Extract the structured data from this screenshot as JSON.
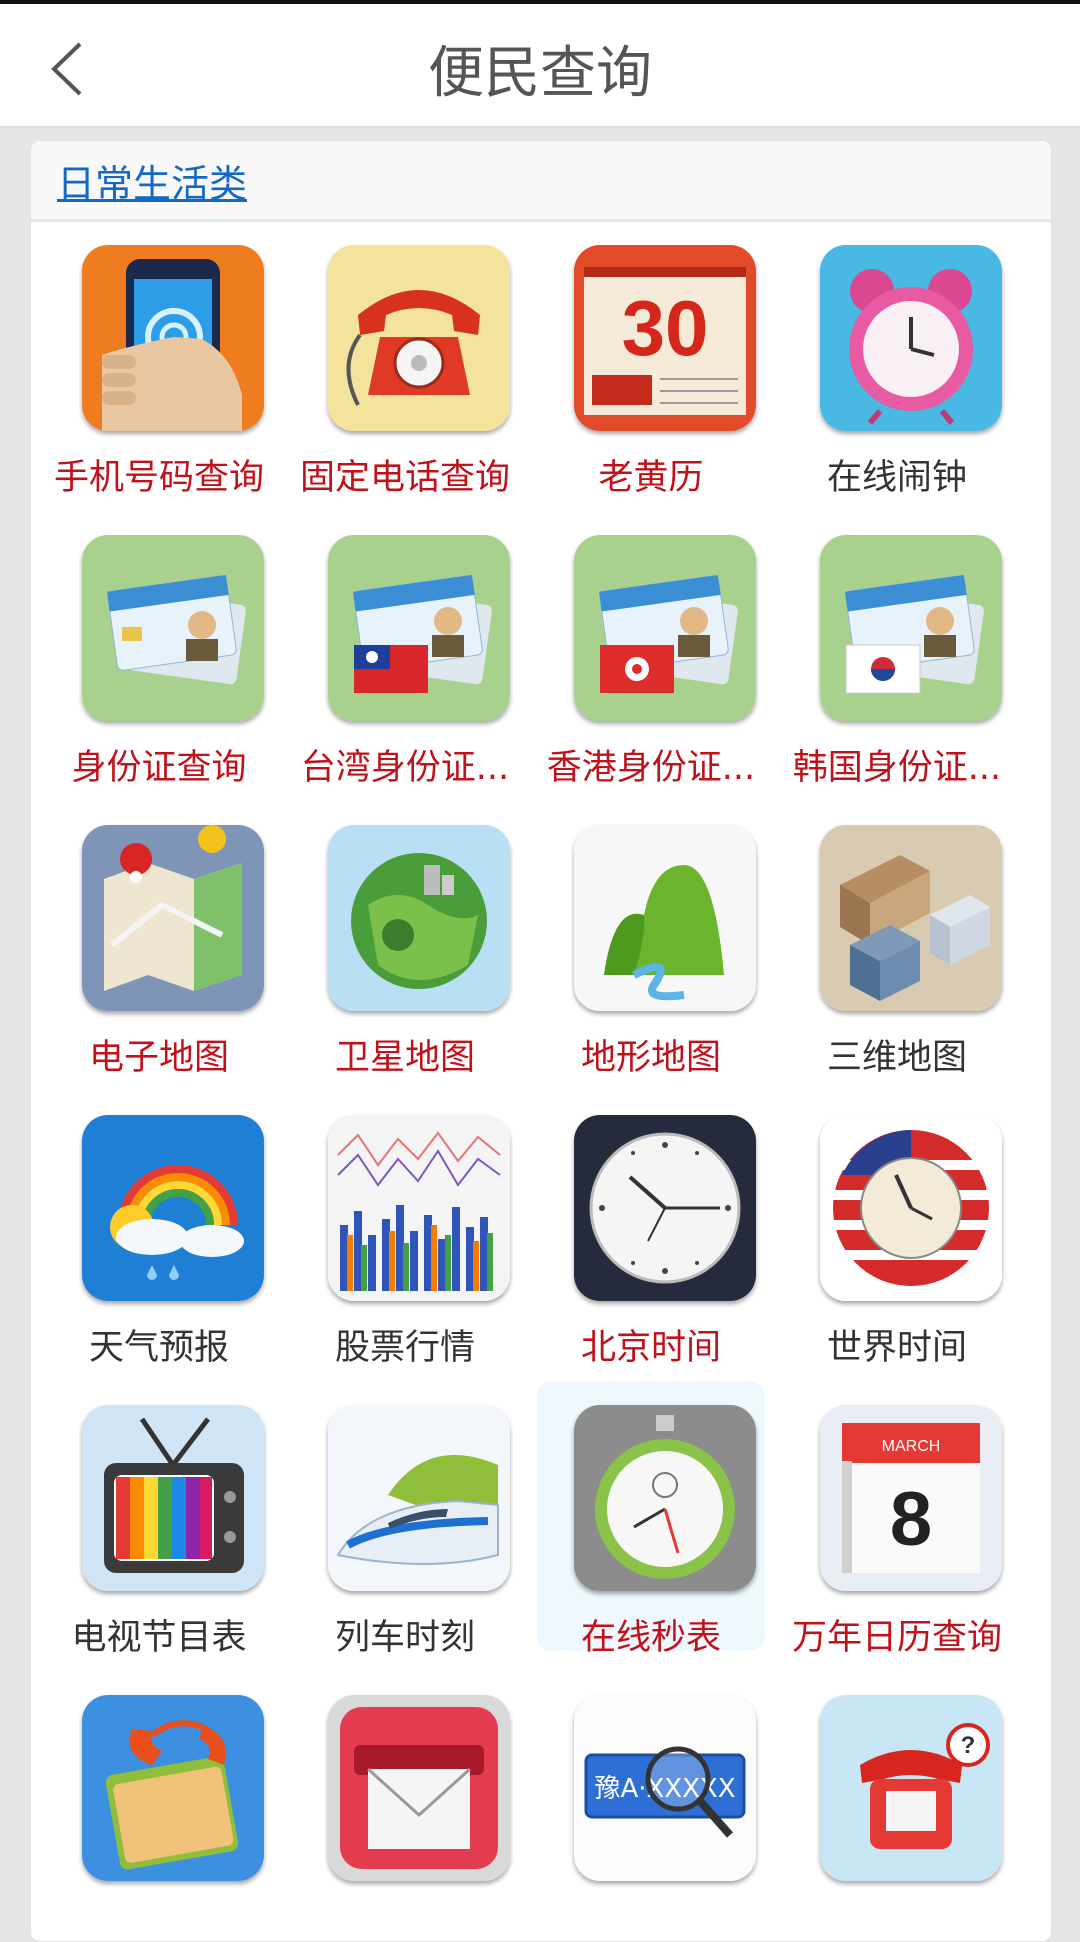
{
  "header": {
    "title": "便民查询"
  },
  "section": {
    "title": "日常生活类"
  },
  "items": [
    {
      "label": "手机号码查询",
      "icon": "mobile-phone-icon",
      "color": "red"
    },
    {
      "label": "固定电话查询",
      "icon": "landline-phone-icon",
      "color": "red"
    },
    {
      "label": "老黄历",
      "icon": "old-almanac-calendar-icon",
      "color": "red"
    },
    {
      "label": "在线闹钟",
      "icon": "alarm-clock-icon",
      "color": "dark"
    },
    {
      "label": "身份证查询",
      "icon": "id-card-icon",
      "color": "red"
    },
    {
      "label": "台湾身份证...",
      "icon": "taiwan-id-card-icon",
      "color": "red"
    },
    {
      "label": "香港身份证...",
      "icon": "hongkong-id-card-icon",
      "color": "red"
    },
    {
      "label": "韩国身份证...",
      "icon": "korea-id-card-icon",
      "color": "red"
    },
    {
      "label": "电子地图",
      "icon": "folded-map-icon",
      "color": "red"
    },
    {
      "label": "卫星地图",
      "icon": "satellite-globe-icon",
      "color": "red"
    },
    {
      "label": "地形地图",
      "icon": "terrain-mountain-icon",
      "color": "red"
    },
    {
      "label": "三维地图",
      "icon": "3d-city-icon",
      "color": "dark"
    },
    {
      "label": "天气预报",
      "icon": "weather-rainbow-icon",
      "color": "dark"
    },
    {
      "label": "股票行情",
      "icon": "stock-chart-icon",
      "color": "dark"
    },
    {
      "label": "北京时间",
      "icon": "wall-clock-icon",
      "color": "red"
    },
    {
      "label": "世界时间",
      "icon": "usa-flag-clock-icon",
      "color": "dark"
    },
    {
      "label": "电视节目表",
      "icon": "tv-icon",
      "color": "dark"
    },
    {
      "label": "列车时刻",
      "icon": "bullet-train-icon",
      "color": "dark"
    },
    {
      "label": "在线秒表",
      "icon": "stopwatch-icon",
      "color": "red"
    },
    {
      "label": "万年日历查询",
      "icon": "march-calendar-icon",
      "color": "red"
    },
    {
      "label": "",
      "icon": "phone-book-icon",
      "color": "dark"
    },
    {
      "label": "",
      "icon": "mail-envelope-icon",
      "color": "dark"
    },
    {
      "label": "",
      "icon": "license-plate-search-icon",
      "color": "dark"
    },
    {
      "label": "",
      "icon": "red-telephone-help-icon",
      "color": "dark"
    }
  ],
  "colors": {
    "red_label": "#c0121b",
    "dark_label": "#333333",
    "link": "#1469c7"
  },
  "calendar": {
    "almanac_day": "30",
    "month_word": "MARCH",
    "month_day": "8"
  },
  "plate": {
    "text": "豫A·XXXXX"
  }
}
